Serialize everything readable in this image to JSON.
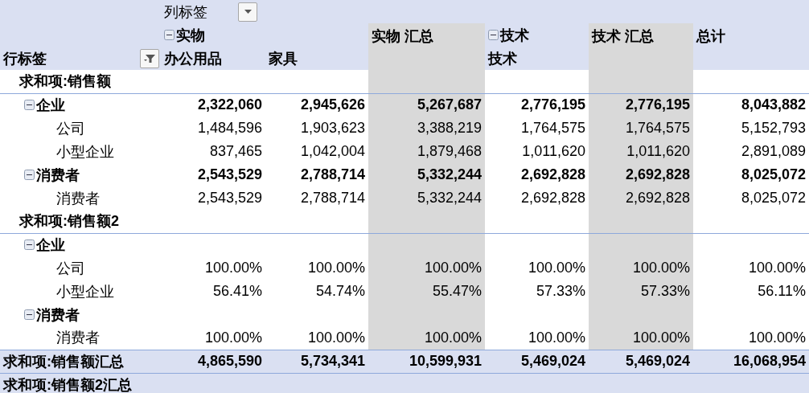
{
  "header": {
    "column_label": "列标签",
    "row_label": "行标签",
    "columns": [
      {
        "kind": "item",
        "group": "实物",
        "expanded": true,
        "label": "办公用品"
      },
      {
        "kind": "item",
        "label": "家具"
      },
      {
        "kind": "subtotal",
        "label": "实物 汇总"
      },
      {
        "kind": "item",
        "group": "技术",
        "expanded": true,
        "label": "技术"
      },
      {
        "kind": "subtotal",
        "label": "技术 汇总"
      },
      {
        "kind": "grand",
        "label": "总计"
      }
    ]
  },
  "rows": [
    {
      "kind": "section",
      "label": "求和项:销售额"
    },
    {
      "kind": "group",
      "label": "企业",
      "expanded": true,
      "values": [
        "2,322,060",
        "2,945,626",
        "5,267,687",
        "2,776,195",
        "2,776,195",
        "8,043,882"
      ]
    },
    {
      "kind": "item",
      "label": "公司",
      "values": [
        "1,484,596",
        "1,903,623",
        "3,388,219",
        "1,764,575",
        "1,764,575",
        "5,152,793"
      ]
    },
    {
      "kind": "item",
      "label": "小型企业",
      "values": [
        "837,465",
        "1,042,004",
        "1,879,468",
        "1,011,620",
        "1,011,620",
        "2,891,089"
      ]
    },
    {
      "kind": "group",
      "label": "消费者",
      "expanded": true,
      "values": [
        "2,543,529",
        "2,788,714",
        "5,332,244",
        "2,692,828",
        "2,692,828",
        "8,025,072"
      ]
    },
    {
      "kind": "item",
      "label": "消费者",
      "values": [
        "2,543,529",
        "2,788,714",
        "5,332,244",
        "2,692,828",
        "2,692,828",
        "8,025,072"
      ]
    },
    {
      "kind": "section",
      "label": "求和项:销售额2"
    },
    {
      "kind": "group",
      "label": "企业",
      "expanded": true
    },
    {
      "kind": "item",
      "label": "公司",
      "values": [
        "100.00%",
        "100.00%",
        "100.00%",
        "100.00%",
        "100.00%",
        "100.00%"
      ]
    },
    {
      "kind": "item",
      "label": "小型企业",
      "values": [
        "56.41%",
        "54.74%",
        "55.47%",
        "57.33%",
        "57.33%",
        "56.11%"
      ]
    },
    {
      "kind": "group",
      "label": "消费者",
      "expanded": true
    },
    {
      "kind": "item",
      "label": "消费者",
      "values": [
        "100.00%",
        "100.00%",
        "100.00%",
        "100.00%",
        "100.00%",
        "100.00%"
      ]
    },
    {
      "kind": "total",
      "label": "求和项:销售额汇总",
      "values": [
        "4,865,590",
        "5,734,341",
        "10,599,931",
        "5,469,024",
        "5,469,024",
        "16,068,954"
      ]
    },
    {
      "kind": "total",
      "label": "求和项:销售额2汇总"
    }
  ]
}
